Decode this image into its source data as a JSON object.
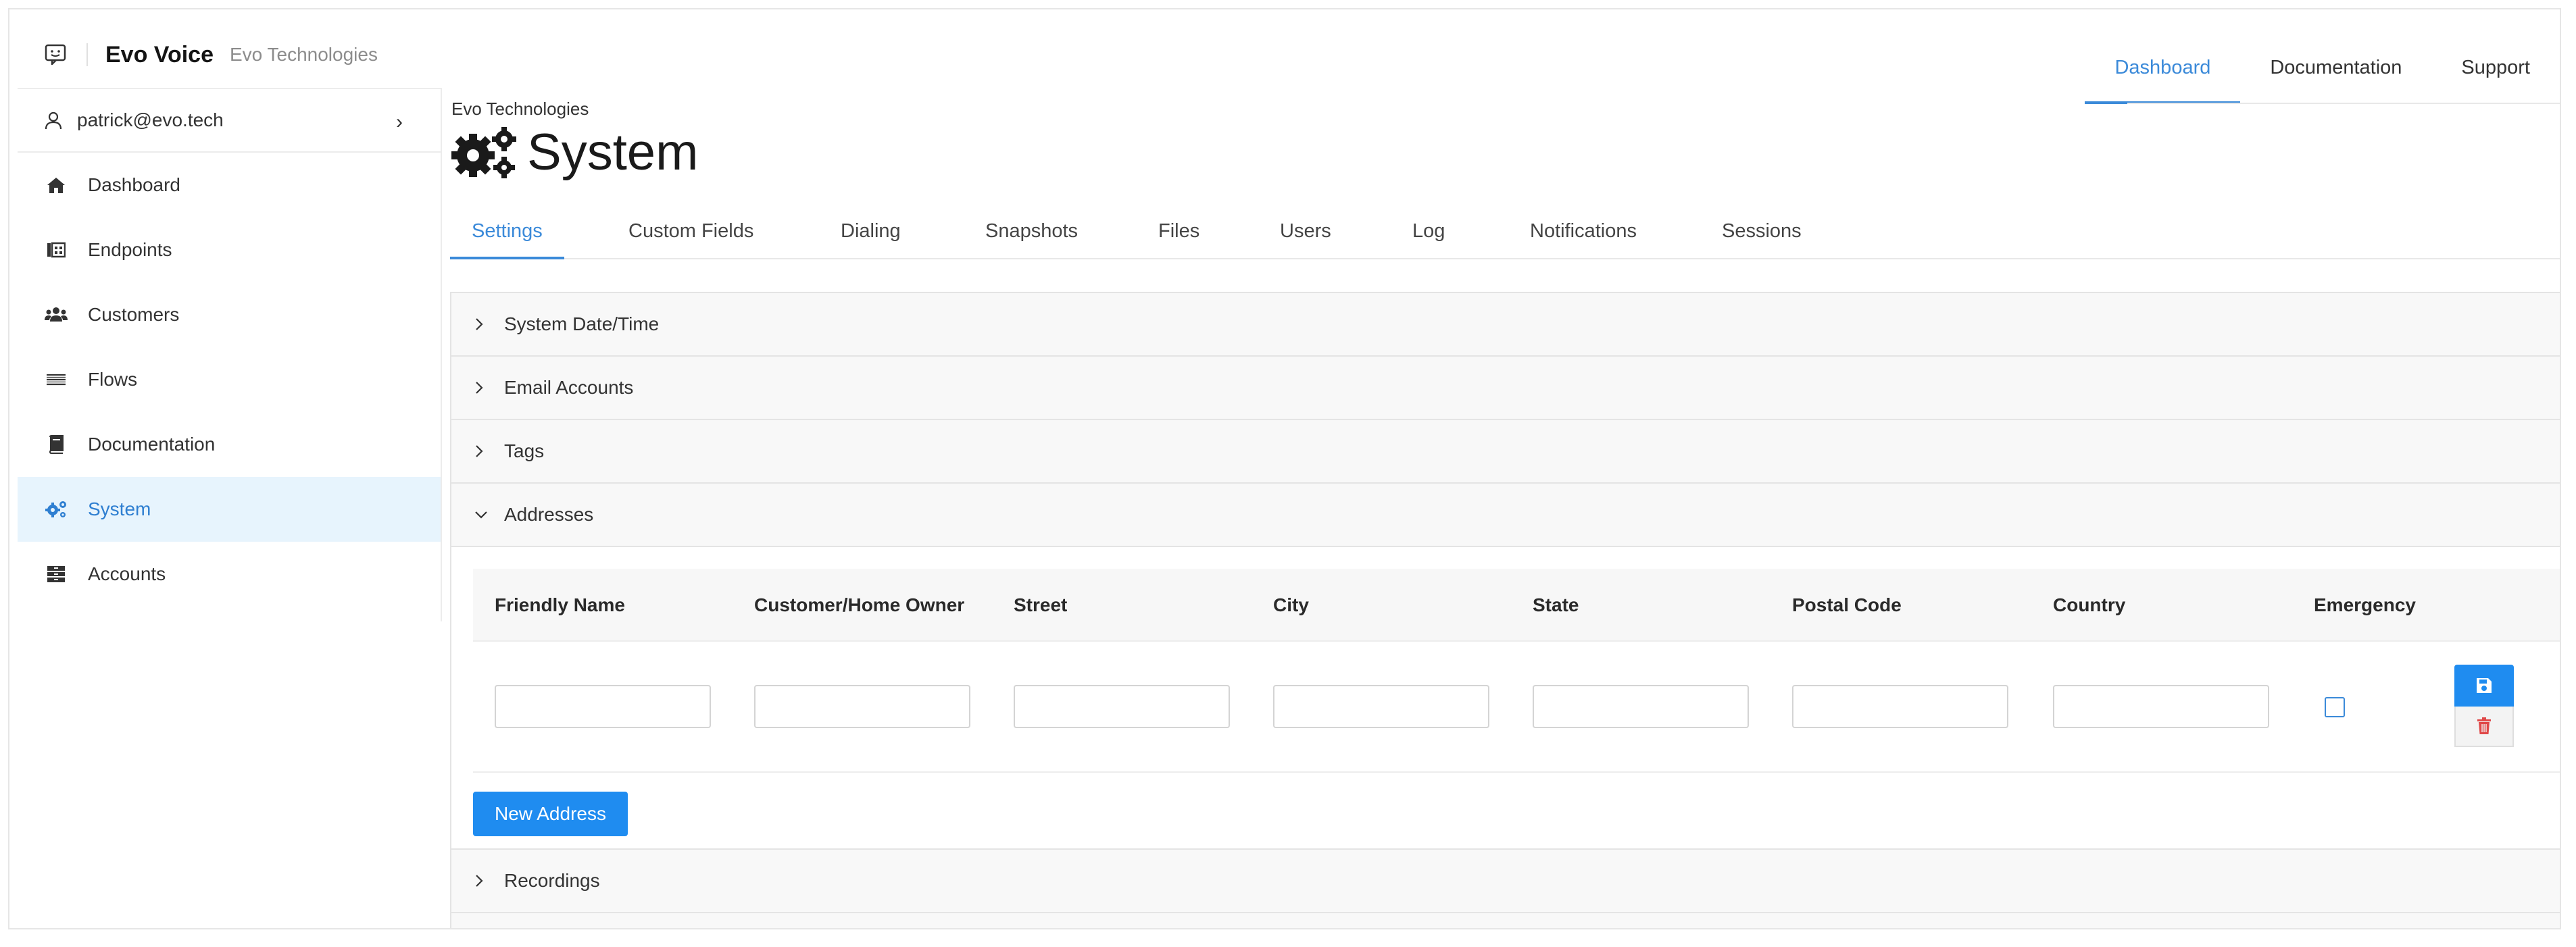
{
  "app": {
    "name": "Evo Voice",
    "org": "Evo Technologies"
  },
  "topnav": [
    {
      "label": "Dashboard",
      "active": true
    },
    {
      "label": "Documentation",
      "active": false
    },
    {
      "label": "Support",
      "active": false
    }
  ],
  "user": {
    "email": "patrick@evo.tech"
  },
  "sidebar": {
    "items": [
      {
        "label": "Dashboard",
        "icon": "home-icon",
        "active": false
      },
      {
        "label": "Endpoints",
        "icon": "endpoints-icon",
        "active": false
      },
      {
        "label": "Customers",
        "icon": "users-icon",
        "active": false
      },
      {
        "label": "Flows",
        "icon": "flows-icon",
        "active": false
      },
      {
        "label": "Documentation",
        "icon": "book-icon",
        "active": false
      },
      {
        "label": "System",
        "icon": "cogs-icon",
        "active": true
      },
      {
        "label": "Accounts",
        "icon": "accounts-icon",
        "active": false
      }
    ]
  },
  "page": {
    "breadcrumb": "Evo Technologies",
    "title": "System"
  },
  "tabs": [
    {
      "label": "Settings",
      "active": true
    },
    {
      "label": "Custom Fields",
      "active": false
    },
    {
      "label": "Dialing",
      "active": false
    },
    {
      "label": "Snapshots",
      "active": false
    },
    {
      "label": "Files",
      "active": false
    },
    {
      "label": "Users",
      "active": false
    },
    {
      "label": "Log",
      "active": false
    },
    {
      "label": "Notifications",
      "active": false
    },
    {
      "label": "Sessions",
      "active": false
    }
  ],
  "sections": {
    "datetime": {
      "label": "System Date/Time",
      "expanded": false
    },
    "email": {
      "label": "Email Accounts",
      "expanded": false
    },
    "tags": {
      "label": "Tags",
      "expanded": false
    },
    "addresses": {
      "label": "Addresses",
      "expanded": true
    },
    "recordings": {
      "label": "Recordings",
      "expanded": false
    }
  },
  "addresses": {
    "columns": [
      "Friendly Name",
      "Customer/Home Owner",
      "Street",
      "City",
      "State",
      "Postal Code",
      "Country",
      "Emergency"
    ],
    "rows": [
      {
        "friendly_name": "",
        "customer": "",
        "street": "",
        "city": "",
        "state": "",
        "postal_code": "",
        "country": "",
        "emergency": false
      }
    ],
    "new_button": "New Address"
  },
  "colors": {
    "accent": "#1f8cf0",
    "link": "#3b8ad9",
    "active_bg": "#e7f4fd",
    "danger": "#e04848"
  }
}
